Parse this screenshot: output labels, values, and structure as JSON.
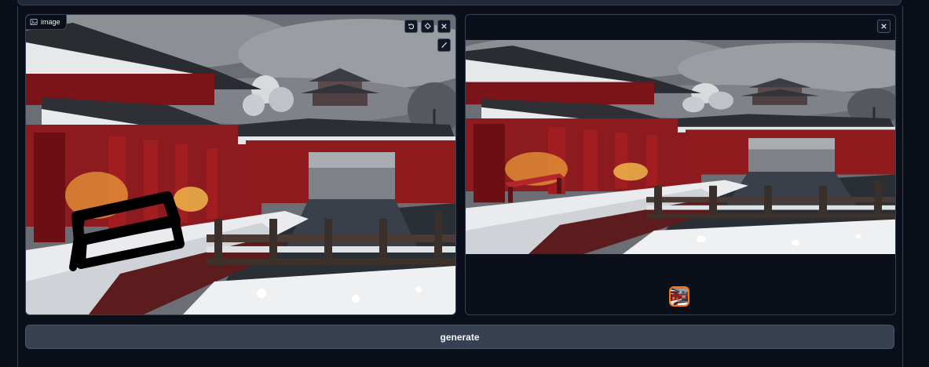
{
  "left_panel": {
    "label": "image",
    "label_icon": "image-icon",
    "tools": [
      "undo-icon",
      "eraser-icon",
      "close-icon"
    ],
    "brush_icon": "brush-icon"
  },
  "right_panel": {
    "close_icon": "close-icon",
    "thumbnail_selected": true
  },
  "generate_button": {
    "label": "generate"
  },
  "colors": {
    "background": "#0b0f19",
    "panel_border": "#374151",
    "button_bg": "#374151",
    "thumbnail_accent": "#f97316"
  }
}
